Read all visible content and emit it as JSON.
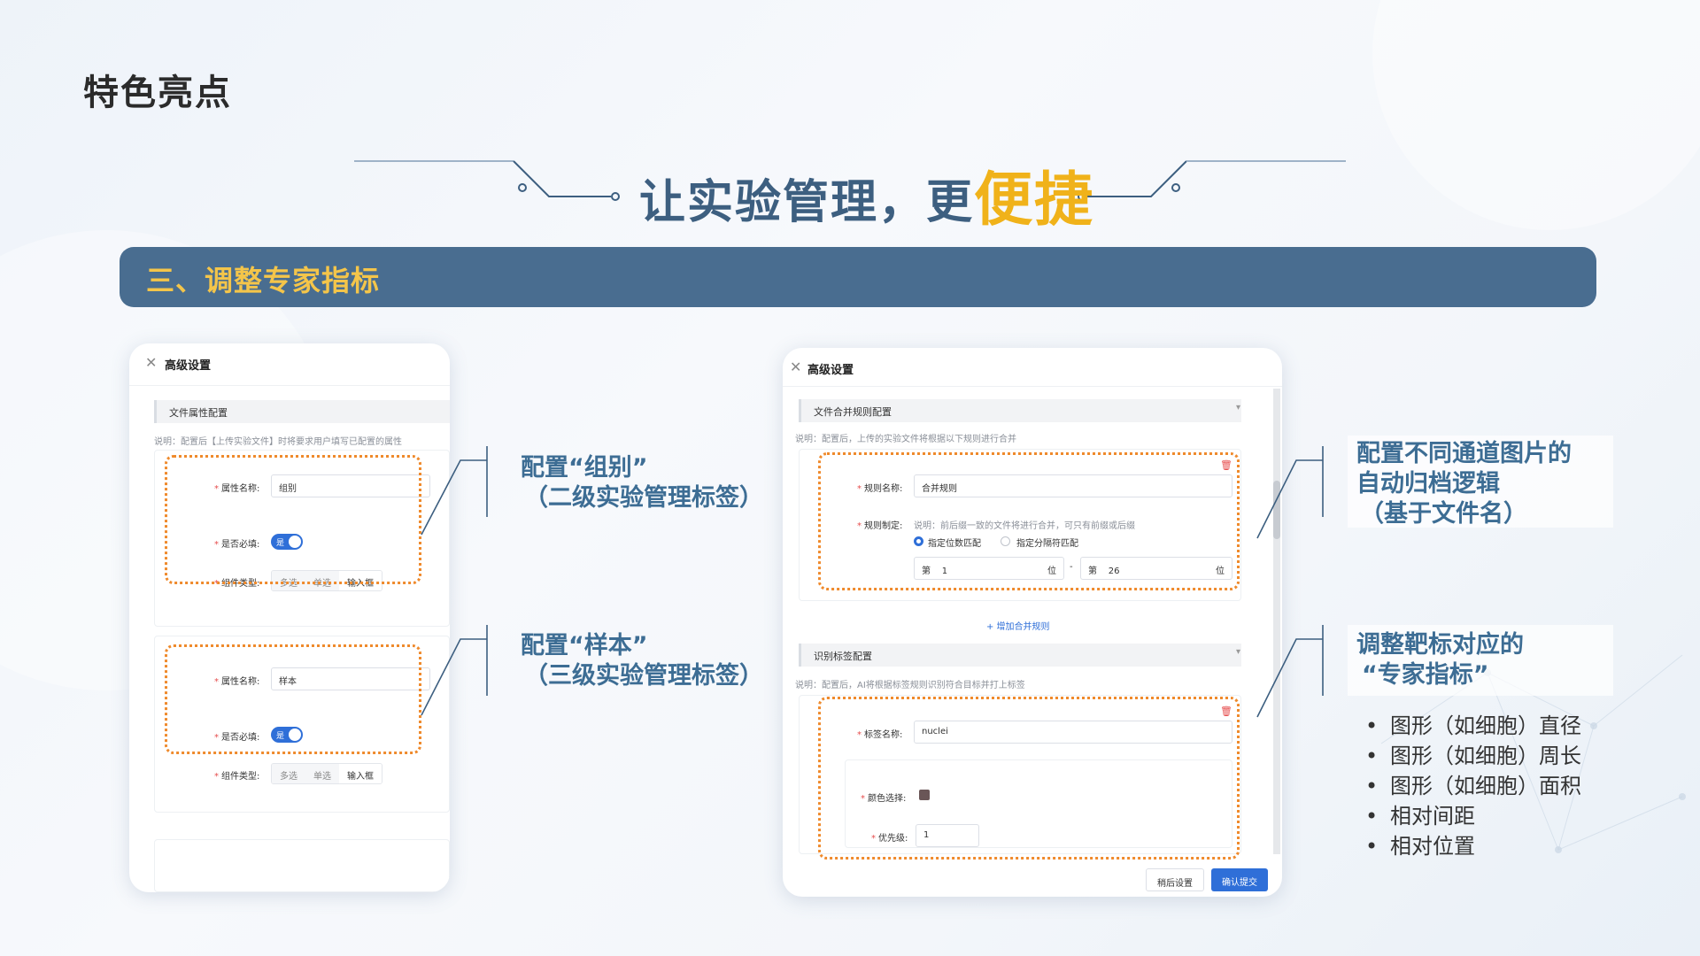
{
  "page": {
    "title": "特色亮点",
    "headline_main": "让实验管理，更",
    "headline_highlight": "便捷",
    "section_title": "三、调整专家指标"
  },
  "left_panel": {
    "title": "高级设置",
    "section_label": "文件属性配置",
    "note": "说明：配置后【上传实验文件】时将要求用户填写已配置的属性",
    "group1": {
      "attr_label": "属性名称:",
      "attr_value": "组别",
      "required_label": "是否必填:",
      "toggle_text": "是",
      "type_label": "组件类型:",
      "types": [
        "多选",
        "单选",
        "输入框"
      ]
    },
    "group2": {
      "attr_label": "属性名称:",
      "attr_value": "样本",
      "required_label": "是否必填:",
      "toggle_text": "是",
      "type_label": "组件类型:",
      "types": [
        "多选",
        "单选",
        "输入框"
      ]
    }
  },
  "right_panel": {
    "title": "高级设置",
    "merge_section_label": "文件合并规则配置",
    "merge_note": "说明：配置后，上传的实验文件将根据以下规则进行合并",
    "rule_name_label": "规则名称:",
    "rule_name_value": "合并规则",
    "rule_make_label": "规则制定:",
    "rule_make_note": "说明：前后缀一致的文件将进行合并，可只有前缀或后缀",
    "radio1": "指定位数匹配",
    "radio2": "指定分隔符匹配",
    "pos_prefix": "第",
    "pos_from": "1",
    "pos_unit": "位",
    "pos_sep": "-",
    "pos_prefix2": "第",
    "pos_to": "26",
    "pos_unit2": "位",
    "add_rule": "+ 增加合并规则",
    "label_section_label": "识别标签配置",
    "label_note": "说明：配置后，AI将根据标签规则识别符合目标并打上标签",
    "tag_name_label": "标签名称:",
    "tag_name_value": "nuclei",
    "color_label": "颜色选择:",
    "priority_label": "优先级:",
    "priority_value": "1",
    "btn_later": "稍后设置",
    "btn_submit": "确认提交",
    "colors": {
      "swatch": "#6a5657",
      "primary": "#2f6fd8"
    }
  },
  "callouts": {
    "group": [
      "配置“组别”",
      "（二级实验管理标签）"
    ],
    "sample": [
      "配置“样本”",
      "（三级实验管理标签）"
    ],
    "channel": [
      "配置不同通道图片的",
      "自动归档逻辑",
      "（基于文件名）"
    ],
    "target": [
      "调整靶标对应的",
      "“专家指标”"
    ]
  },
  "bullets": [
    "图形（如细胞）直径",
    "图形（如细胞）周长",
    "图形（如细胞）面积",
    "相对间距",
    "相对位置"
  ],
  "colors": {
    "section_bar": "#496d90",
    "section_text": "#f4c54a",
    "headline": "#3d5f80",
    "highlight": "#f0b21a",
    "callout": "#3d6d94",
    "dash": "#ef8a2c"
  }
}
